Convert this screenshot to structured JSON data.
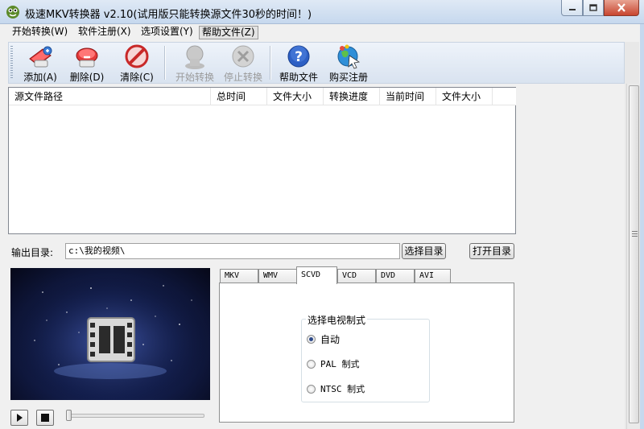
{
  "window": {
    "title": "极速MKV转换器 v2.10(试用版只能转换源文件30秒的时间！)"
  },
  "menu": [
    {
      "label": "开始转换(W)"
    },
    {
      "label": "软件注册(X)"
    },
    {
      "label": "选项设置(Y)"
    },
    {
      "label": "帮助文件(Z)"
    }
  ],
  "toolbar": {
    "add": "添加(A)",
    "delete": "删除(D)",
    "clear": "清除(C)",
    "start": "开始转换",
    "stop": "停止转换",
    "help": "帮助文件",
    "buy": "购买注册"
  },
  "file_list": {
    "columns": [
      "源文件路径",
      "总时间",
      "文件大小",
      "转换进度",
      "当前时间",
      "文件大小"
    ]
  },
  "output": {
    "label": "输出目录:",
    "path": "c:\\我的视频\\",
    "choose_button": "选择目录",
    "open_button": "打开目录"
  },
  "tabs": [
    "MKV",
    "WMV",
    "SCVD",
    "VCD",
    "DVD",
    "AVI"
  ],
  "active_tab": "SCVD",
  "tv_format": {
    "title": "选择电视制式",
    "options": [
      "自动",
      "PAL 制式",
      "NTSC 制式"
    ],
    "selected": "自动"
  },
  "player": {
    "progress": 0
  },
  "colors": {
    "titlebar": "#c6d8ee",
    "toolbar": "#dfe7f2",
    "close_button": "#c8452f",
    "preview_bg": "#142052"
  }
}
